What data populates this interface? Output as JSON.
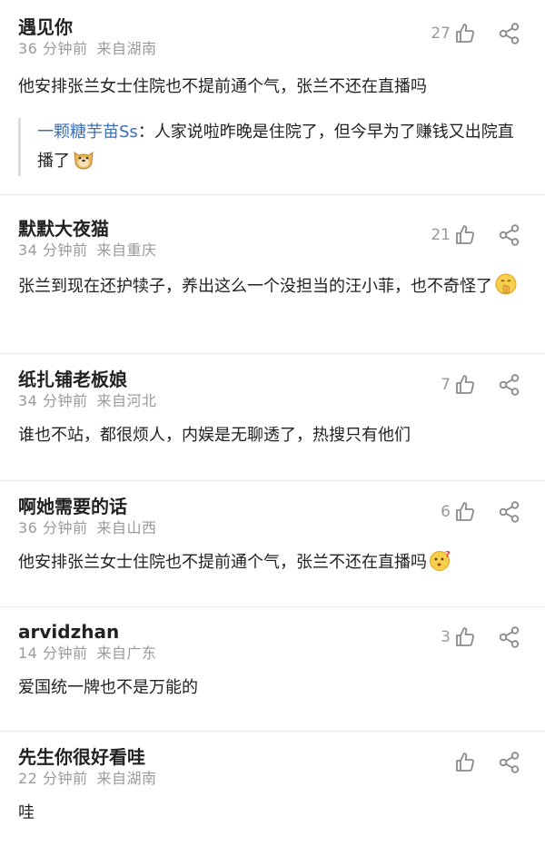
{
  "comments": [
    {
      "username": "遇见你",
      "time": "36 分钟前",
      "location": "来自湖南",
      "likes": "27",
      "text": "他安排张兰女士住院也不提前通个气，张兰不还在直播吗",
      "reply": {
        "user": "一颗糖芋苗Ss",
        "text": "：人家说啦昨晚是住院了，但今早为了赚钱又出院直播了"
      }
    },
    {
      "username": "默默大夜猫",
      "time": "34 分钟前",
      "location": "来自重庆",
      "likes": "21",
      "text": "张兰到现在还护犊子，养出这么一个没担当的汪小菲，也不奇怪了"
    },
    {
      "username": "纸扎铺老板娘",
      "time": "34 分钟前",
      "location": "来自河北",
      "likes": "7",
      "text": "谁也不站，都很烦人，内娱是无聊透了，热搜只有他们"
    },
    {
      "username": "啊她需要的话",
      "time": "36 分钟前",
      "location": "来自山西",
      "likes": "6",
      "text": "他安排张兰女士住院也不提前通个气，张兰不还在直播吗"
    },
    {
      "username": "arvidzhan",
      "time": "14 分钟前",
      "location": "来自广东",
      "likes": "3",
      "text": "爱国统一牌也不是万能的"
    },
    {
      "username": "先生你很好看哇",
      "time": "22 分钟前",
      "location": "来自湖南",
      "likes": "",
      "text": "哇"
    }
  ],
  "icons": {
    "like": "thumbs-up-icon",
    "share": "share-icon",
    "emoji_doge": "doge-emoji",
    "emoji_shush": "shushing-face-emoji",
    "emoji_confused": "confused-face-emoji"
  },
  "colors": {
    "reply_user": "#3b6fb6",
    "meta": "#9a9a9a",
    "text": "#222222"
  }
}
